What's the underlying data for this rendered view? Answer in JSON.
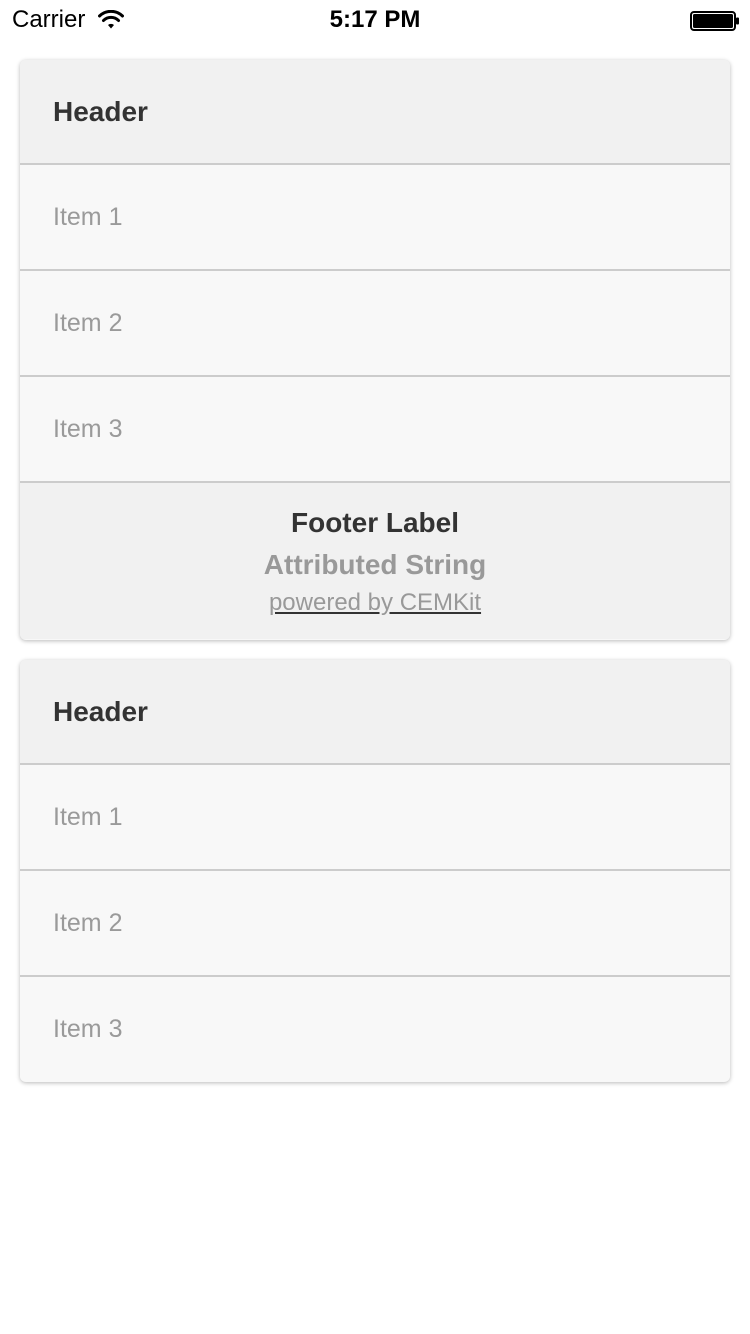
{
  "status_bar": {
    "carrier": "Carrier",
    "time": "5:17 PM",
    "wifi_icon": "wifi-icon",
    "battery_icon": "battery-icon"
  },
  "cards": [
    {
      "header": "Header",
      "items": [
        "Item 1",
        "Item 2",
        "Item 3"
      ],
      "footer": {
        "label": "Footer Label",
        "attributed": "Attributed String",
        "link": "powered by CEMKit"
      }
    },
    {
      "header": "Header",
      "items": [
        "Item 1",
        "Item 2",
        "Item 3"
      ]
    }
  ],
  "colors": {
    "card_background": "#f8f8f8",
    "header_background": "#f1f1f1",
    "separator": "#cccccc",
    "item_text": "#9a9a9a",
    "header_text": "#333333"
  }
}
